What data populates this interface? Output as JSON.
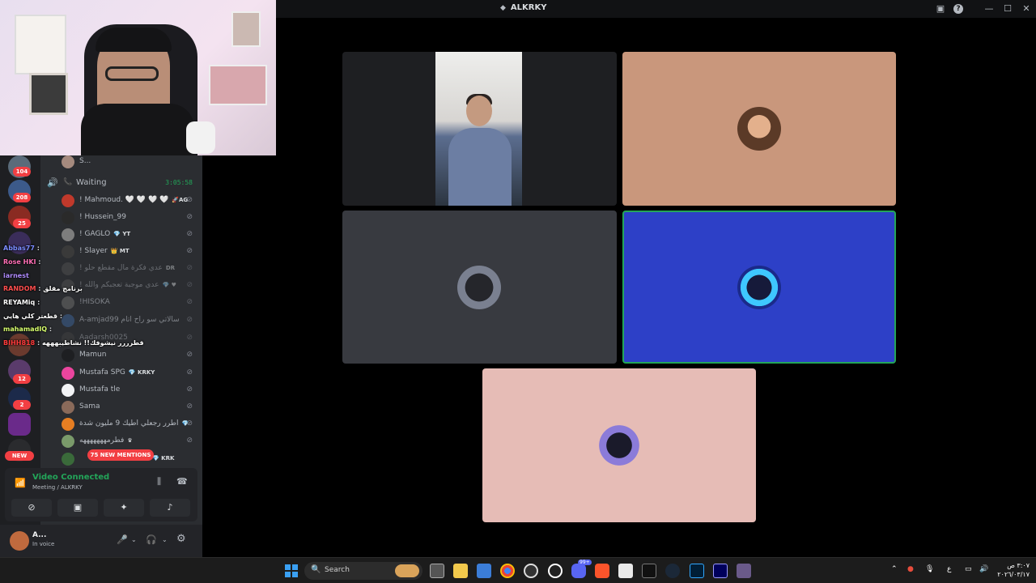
{
  "window": {
    "title": "ALKRKY",
    "title_glyph": "◆"
  },
  "titlebar_icons": {
    "screen": "▣",
    "help": "?",
    "minimize": "—",
    "maximize": "☐",
    "close": "✕"
  },
  "guild_badges": [
    "104",
    "208",
    "25",
    "12",
    "2"
  ],
  "channel": {
    "prev_member": "S...",
    "waiting_name": "Waiting",
    "timer": "3:05:58",
    "members": [
      {
        "name": "! Mahmoud. 🤍 🤍 🤍 🤍",
        "tag": "🚀AG"
      },
      {
        "name": "! Hussein_99",
        "tag": ""
      },
      {
        "name": "! GAGLO",
        "tag": "💎 YT"
      },
      {
        "name": "! Slayer",
        "tag": "👑 MT"
      },
      {
        "name": "! عدي فكرة مال مقطع حلو",
        "tag": "DR"
      },
      {
        "name": "! عدي موجبة تعجبكم والله",
        "tag": "💎 ♥"
      },
      {
        "name": "!HISOKA",
        "tag": ""
      },
      {
        "name": "A-amjad99 سالاتي سو راح اتام",
        "tag": ""
      },
      {
        "name": "Aadarsh0025",
        "tag": ""
      },
      {
        "name": "Mamun",
        "tag": ""
      },
      {
        "name": "Mustafa SPG",
        "tag": "💎 KRKY"
      },
      {
        "name": "Mustafa tle",
        "tag": ""
      },
      {
        "name": "Sama",
        "tag": ""
      },
      {
        "name": "اطرر رجعلي اطيك 9 مليون شدة",
        "tag": "💎"
      },
      {
        "name": "فطرمهههههههه",
        "tag": "♛"
      },
      {
        "name": "",
        "tag": "💎 KRK"
      }
    ],
    "new_label": "NEW",
    "new_mentions": "75 NEW MENTIONS"
  },
  "stream_chat": [
    {
      "user": "Abbas77",
      "text": "",
      "color": "#7b8cff"
    },
    {
      "user": "Rose HKI",
      "text": "",
      "color": "#ff6fb5"
    },
    {
      "user": "iarnest",
      "text": "",
      "color": "#b08cff"
    },
    {
      "user": "RANDOM",
      "text": "برنامج مقلق",
      "color": "#ff4e4e"
    },
    {
      "user": "REYAMiq",
      "text": "",
      "color": "#ffffff"
    },
    {
      "user": "",
      "text": "قطعتر كلي هايي",
      "color": "#ff7272"
    },
    {
      "user": "mahamadIQ",
      "text": "",
      "color": "#d8ff6e"
    },
    {
      "user": "BIHH818",
      "text": "قطرررر نيشوفك!! نشاطيبهههه",
      "color": "#ff3b3b"
    }
  ],
  "voice": {
    "status": "Video Connected",
    "location": "Meeting / ALKRKY",
    "buttons": [
      "camera-off",
      "screen-share",
      "activities",
      "soundboard"
    ]
  },
  "user": {
    "name": "A...",
    "status": "In voice"
  },
  "taskbar": {
    "search_label": "Search",
    "time": "٣:٠٧ ص",
    "date": "٢٠٢٦/٠٣/١٧",
    "lang": "ع",
    "discord_badge": "99+"
  },
  "colors": {
    "tile_dark": "#1e1f22",
    "tile_gray": "#383a40",
    "tile_tan": "#c9977c",
    "tile_blue": "#2d40c7",
    "tile_pink": "#e6bcb6",
    "speaking_border": "#23a559"
  }
}
